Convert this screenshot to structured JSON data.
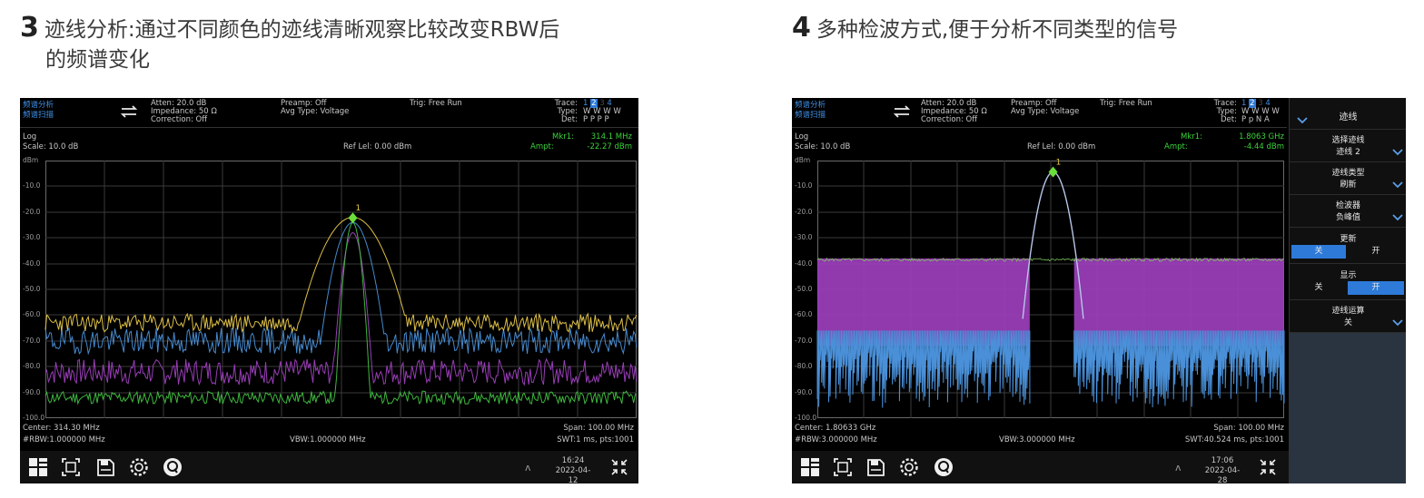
{
  "left_heading": {
    "num": "3",
    "line1": "迹线分析:通过不同颜色的迹线清晰观察比较改变RBW后",
    "line2": "的频谱变化"
  },
  "right_heading": {
    "num": "4",
    "line1": "多种检波方式,便于分析不同类型的信号"
  },
  "screen1": {
    "mode_line1": "频谱分析",
    "mode_line2": "频谱扫描",
    "atten": "Atten: 20.0 dB",
    "impedance": "Impedance: 50 Ω",
    "correction": "Correction: Off",
    "preamp": "Preamp: Off",
    "avg_type": "Avg Type: Voltage",
    "trig": "Trig: Free Run",
    "trace_label": "Trace:",
    "trace_nums": [
      "1",
      "2",
      "3",
      "4"
    ],
    "type_label": "Type:",
    "type_vals": "W W W W",
    "det_label": "Det:",
    "det_vals": "P P P P",
    "log": "Log",
    "scale": "Scale: 10.0 dB",
    "ref": "Ref Lel: 0.00 dBm",
    "mkr_label": "Mkr1:",
    "mkr_freq": "314.1 MHz",
    "ampt_label": "Ampt:",
    "ampt_val": "-22.27 dBm",
    "marker_num": "1",
    "y_unit": "dBm",
    "y_ticks": [
      "-10.0",
      "-20.0",
      "-30.0",
      "-40.0",
      "-50.0",
      "-60.0",
      "-70.0",
      "-80.0",
      "-90.0",
      "-100.0"
    ],
    "center": "Center: 314.30 MHz",
    "rbw": "#RBW:1.000000 MHz",
    "vbw": "VBW:1.000000 MHz",
    "span": "Span: 100.00 MHz",
    "swt": "SWT:1 ms, pts:1001",
    "time": "16:24",
    "date": "2022-04-12"
  },
  "screen2": {
    "mode_line1": "频谱分析",
    "mode_line2": "频谱扫描",
    "atten": "Atten: 20.0 dB",
    "impedance": "Impedance: 50 Ω",
    "correction": "Correction: Off",
    "preamp": "Preamp: Off",
    "avg_type": "Avg Type: Voltage",
    "trig": "Trig: Free Run",
    "trace_label": "Trace:",
    "trace_nums": [
      "1",
      "2",
      "3",
      "4"
    ],
    "type_label": "Type:",
    "type_vals": "W W W W",
    "det_label": "Det:",
    "det_vals": "P p N A",
    "log": "Log",
    "scale": "Scale: 10.0 dB",
    "ref": "Ref Lel: 0.00 dBm",
    "mkr_label": "Mkr1:",
    "mkr_freq": "1.8063 GHz",
    "ampt_label": "Ampt:",
    "ampt_val": "-4.44 dBm",
    "marker_num": "1",
    "y_unit": "dBm",
    "y_ticks": [
      "-10.0",
      "-20.0",
      "-30.0",
      "-40.0",
      "-50.0",
      "-60.0",
      "-70.0",
      "-80.0",
      "-90.0",
      "-100.0"
    ],
    "center": "Center: 1.80633 GHz",
    "rbw": "#RBW:3.000000 MHz",
    "vbw": "VBW:3.000000 MHz",
    "span": "Span: 100.00 MHz",
    "swt": "SWT:40.524 ms, pts:1001",
    "time": "17:06",
    "date": "2022-04-28",
    "panel": {
      "title": "迹线",
      "select_trace_label": "选择迹线",
      "select_trace_value": "迹线 2",
      "trace_type_label": "迹线类型",
      "trace_type_value": "刷新",
      "detector_label": "检波器",
      "detector_value": "负峰值",
      "update_label": "更新",
      "update_off": "关",
      "update_on": "开",
      "display_label": "显示",
      "display_off": "关",
      "display_on": "开",
      "math_label": "迹线运算",
      "math_value": "关"
    }
  },
  "colors": {
    "trace_yellow": "#e8c84a",
    "trace_blue": "#4a90d8",
    "trace_purple": "#a040c0",
    "trace_green": "#40c040",
    "marker": "#6adf3a",
    "accent_blue": "#2d7ad8"
  }
}
